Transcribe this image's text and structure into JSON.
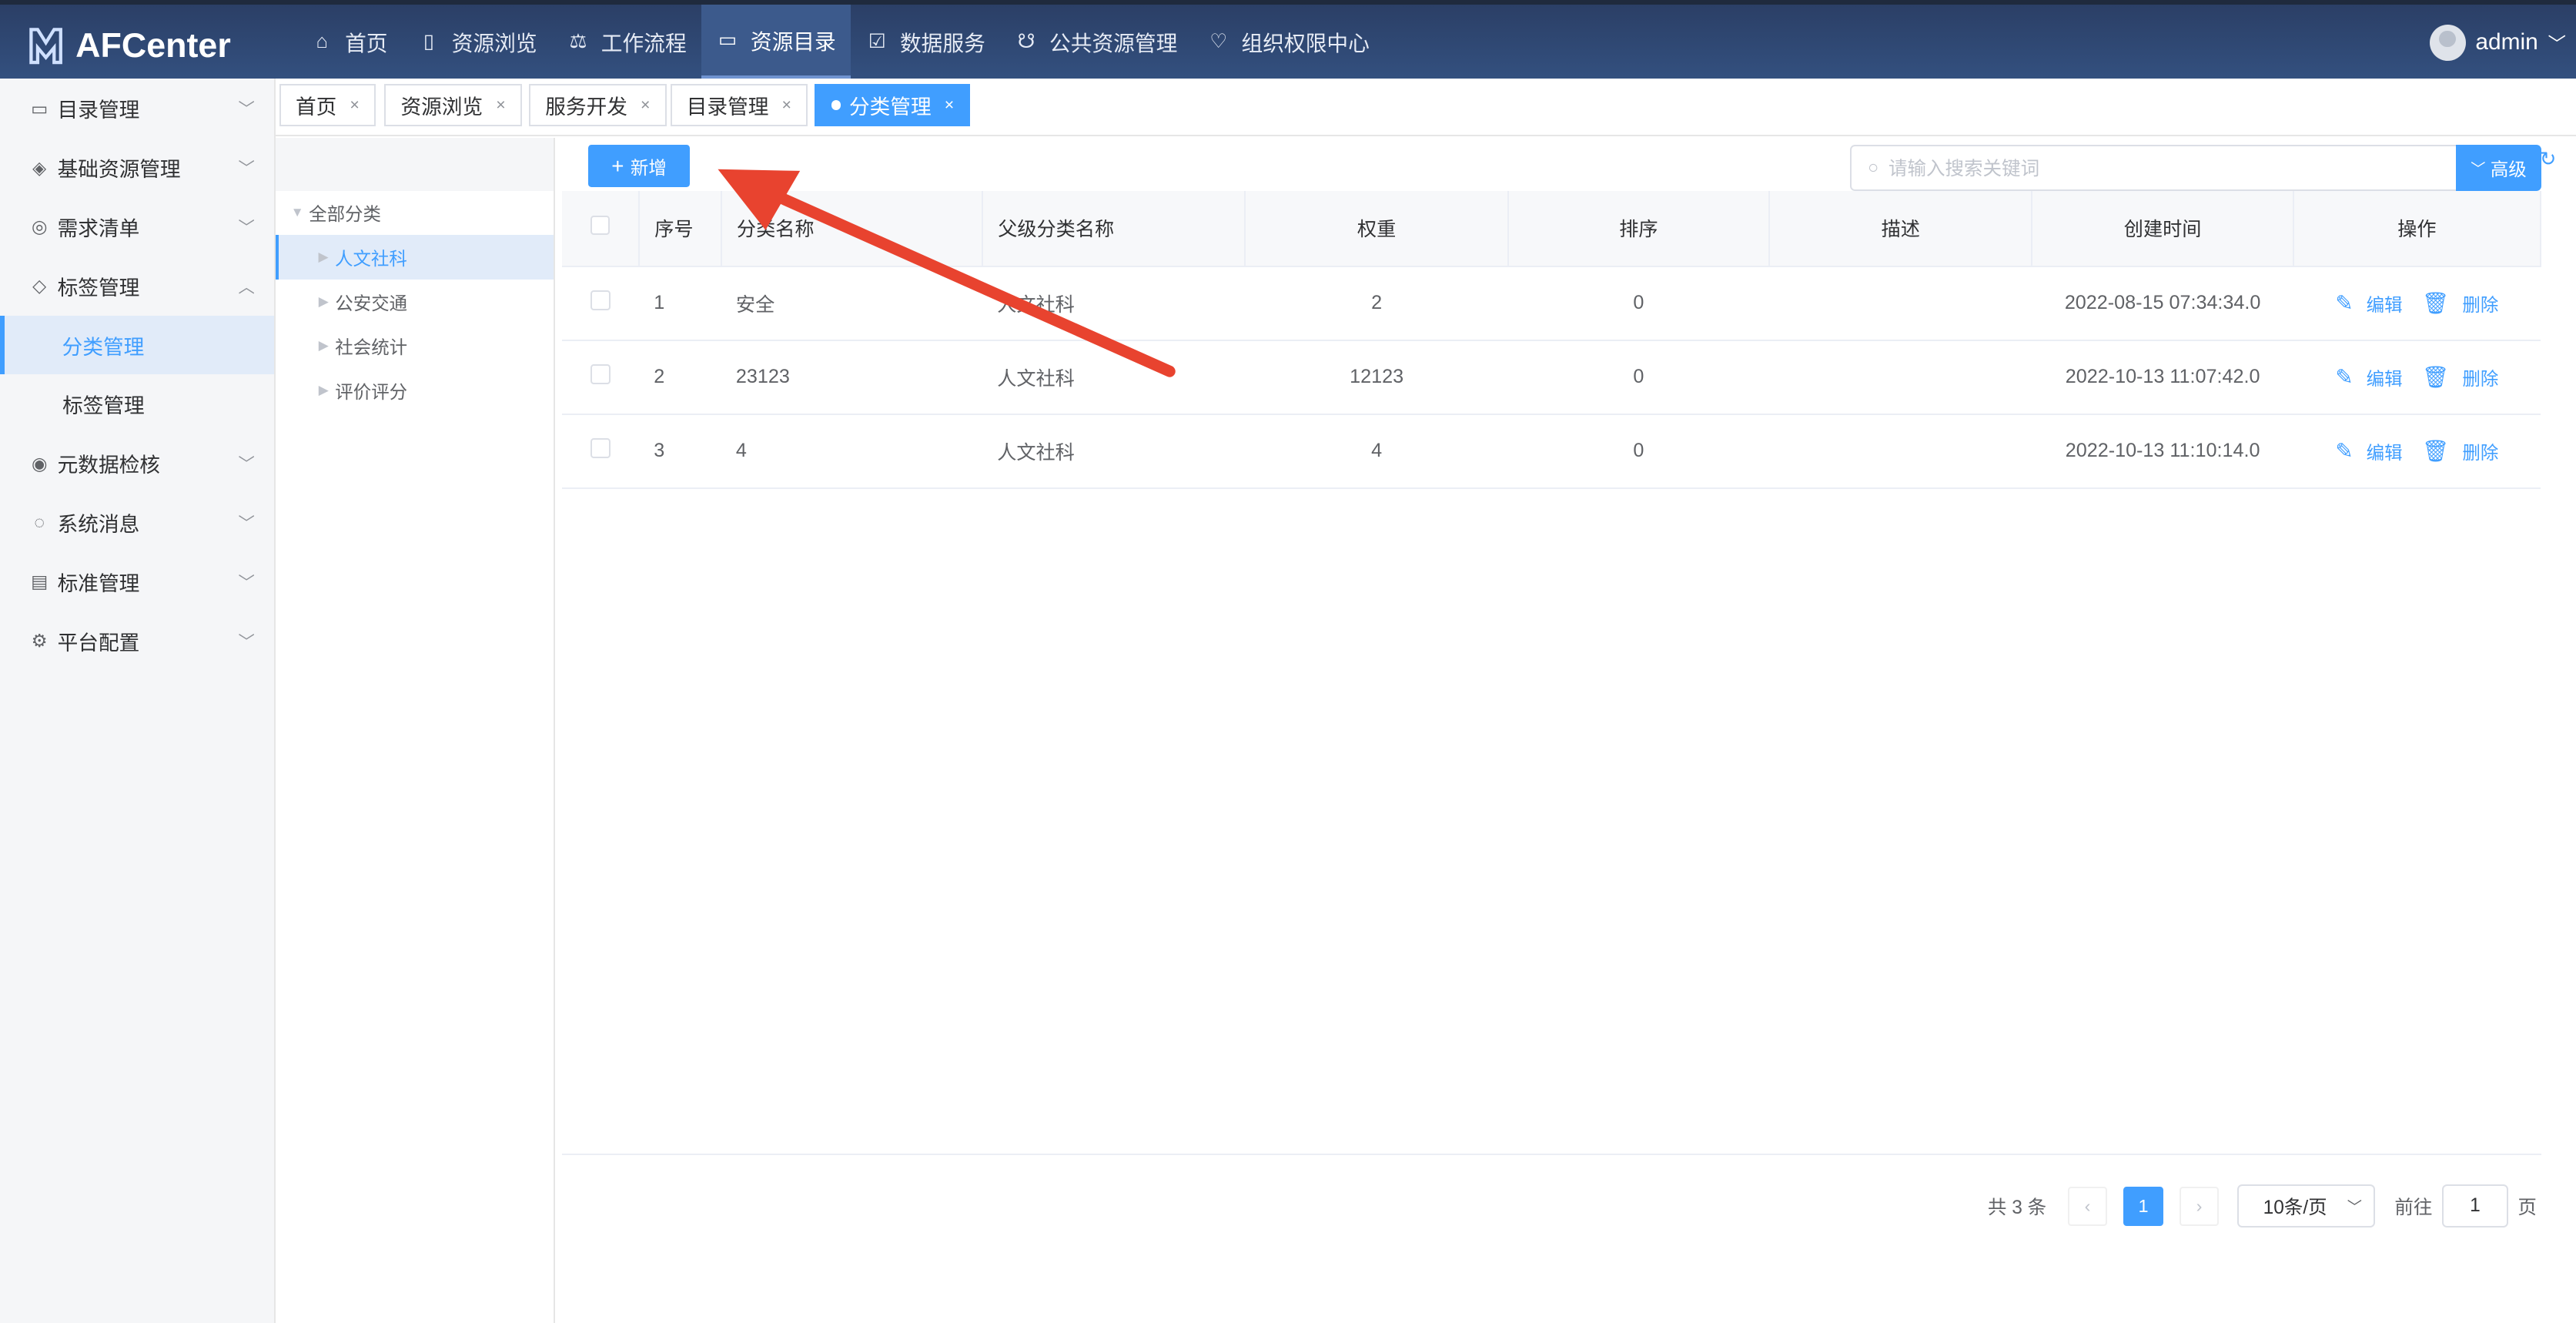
{
  "app": {
    "name": "AFCenter",
    "user": "admin"
  },
  "topnav": [
    {
      "icon": "home-icon",
      "glyph": "⌂",
      "label": "首页"
    },
    {
      "icon": "book-icon",
      "glyph": "▯",
      "label": "资源浏览"
    },
    {
      "icon": "scale-icon",
      "glyph": "⚖",
      "label": "工作流程"
    },
    {
      "icon": "folder-icon",
      "glyph": "▭",
      "label": "资源目录",
      "active": true
    },
    {
      "icon": "calendar-icon",
      "glyph": "☑",
      "label": "数据服务"
    },
    {
      "icon": "people-icon",
      "glyph": "☋",
      "label": "公共资源管理"
    },
    {
      "icon": "heart-icon",
      "glyph": "♡",
      "label": "组织权限中心"
    }
  ],
  "sidebar": {
    "items": [
      {
        "icon": "folder-icon",
        "glyph": "▭",
        "label": "目录管理",
        "arrow": "﹀"
      },
      {
        "icon": "layers-icon",
        "glyph": "◈",
        "label": "基础资源管理",
        "arrow": "﹀"
      },
      {
        "icon": "radar-icon",
        "glyph": "◎",
        "label": "需求清单",
        "arrow": "﹀"
      },
      {
        "icon": "tag-icon",
        "glyph": "◇",
        "label": "标签管理",
        "arrow": "︿",
        "children": [
          {
            "label": "分类管理",
            "active": true
          },
          {
            "label": "标签管理"
          }
        ]
      },
      {
        "icon": "shield-icon",
        "glyph": "◉",
        "label": "元数据检核",
        "arrow": "﹀"
      },
      {
        "icon": "chat-icon",
        "glyph": "◌",
        "label": "系统消息",
        "arrow": "﹀"
      },
      {
        "icon": "clipboard-icon",
        "glyph": "▤",
        "label": "标准管理",
        "arrow": "﹀"
      },
      {
        "icon": "gear-icon",
        "glyph": "⚙",
        "label": "平台配置",
        "arrow": "﹀"
      }
    ]
  },
  "tabs": [
    {
      "label": "首页"
    },
    {
      "label": "资源浏览"
    },
    {
      "label": "服务开发"
    },
    {
      "label": "目录管理"
    },
    {
      "label": "分类管理",
      "active": true
    }
  ],
  "tree": {
    "root": "全部分类",
    "children": [
      {
        "label": "人文社科",
        "active": true
      },
      {
        "label": "公安交通"
      },
      {
        "label": "社会统计"
      },
      {
        "label": "评价评分"
      }
    ]
  },
  "toolbar": {
    "add_label": "新增",
    "search_placeholder": "请输入搜索关键词",
    "advanced_label": "高级"
  },
  "table": {
    "columns": [
      "序号",
      "分类名称",
      "父级分类名称",
      "权重",
      "排序",
      "描述",
      "创建时间",
      "操作"
    ],
    "rows": [
      {
        "index": "1",
        "name": "安全",
        "parent": "人文社科",
        "weight": "2",
        "order": "0",
        "desc": "",
        "created": "2022-08-15 07:34:34.0"
      },
      {
        "index": "2",
        "name": "23123",
        "parent": "人文社科",
        "weight": "12123",
        "order": "0",
        "desc": "",
        "created": "2022-10-13 11:07:42.0"
      },
      {
        "index": "3",
        "name": "4",
        "parent": "人文社科",
        "weight": "4",
        "order": "0",
        "desc": "",
        "created": "2022-10-13 11:10:14.0"
      }
    ],
    "edit_label": "编辑",
    "delete_label": "删除"
  },
  "pagination": {
    "total_text": "共 3 条",
    "current_page": "1",
    "page_size": "10条/页",
    "goto_prefix": "前往",
    "goto_value": "1",
    "goto_suffix": "页"
  },
  "colors": {
    "primary": "#409eff",
    "topbar": "#2f4774",
    "annotation_arrow": "#e8432f"
  }
}
